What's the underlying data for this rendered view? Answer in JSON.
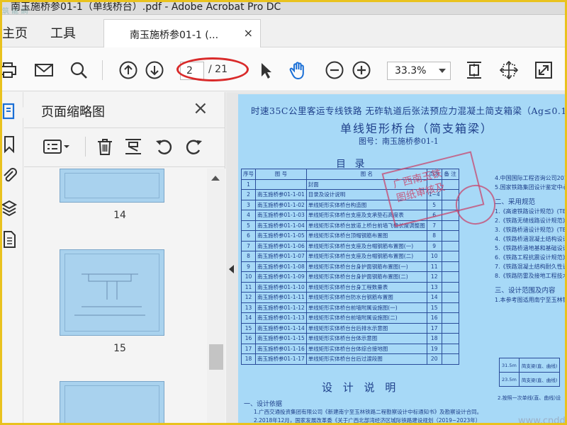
{
  "window": {
    "title": "南玉施桥参01-1（单线桥台）.pdf - Adobe Acrobat Pro DC",
    "logo_text": "筑 龍 網"
  },
  "menu": {
    "home": "主页",
    "tools": "工具"
  },
  "tab": {
    "label": "南玉施桥参01-1 (...",
    "close": "×"
  },
  "toolbar": {
    "page_current": "2",
    "page_total": "/ 21",
    "zoom": "33.3%",
    "icons": [
      "print-icon",
      "email-icon",
      "search-icon",
      "prev-page-icon",
      "next-page-icon",
      "select-cursor-icon",
      "hand-icon",
      "zoom-out-icon",
      "zoom-in-icon",
      "fit-page-icon",
      "fit-width-icon",
      "fullscreen-icon"
    ],
    "accent_color": "#1a6fd6",
    "annotation_color": "#d92a2a"
  },
  "thumbnails_panel": {
    "title": "页面缩略图",
    "close": "×",
    "tools": [
      "thumbnail-options-icon",
      "delete-icon",
      "crop-icon",
      "rotate-left-icon",
      "rotate-right-icon"
    ],
    "pages": [
      "14",
      "15"
    ]
  },
  "document": {
    "header_line": "时速35C公里客运专线铁路    无砟轨道后张法预应力混凝土简支箱梁（Ag≤0.15g）",
    "title": "单线矩形桥台（简支箱梁）",
    "drawing_no": "图号：南玉施桥参01-1",
    "toc_title": "目 录",
    "toc_headers": [
      "序号",
      "图 号",
      "图 名",
      "页次",
      "备 注"
    ],
    "toc_rows": [
      [
        "1",
        "",
        "封面",
        "",
        ""
      ],
      [
        "2",
        "南玉施桥参01-1-01",
        "目录及设计说明",
        "1~4",
        ""
      ],
      [
        "3",
        "南玉施桥参01-1-02",
        "单线矩形实体桥台构造图",
        "5",
        ""
      ],
      [
        "4",
        "南玉施桥参01-1-03",
        "单线矩形实体桥台支座及支承垫石高度表",
        "6",
        ""
      ],
      [
        "5",
        "南玉施桥参01-1-04",
        "单线矩形实体桥台放道上桥台前墙飞檐长度调整图",
        "7",
        ""
      ],
      [
        "6",
        "南玉施桥参01-1-05",
        "单线矩形实体桥台顶帽钢筋布置图",
        "8",
        ""
      ],
      [
        "7",
        "南玉施桥参01-1-06",
        "单线矩形实体桥台支座及台帽钢筋布置图(一)",
        "9",
        ""
      ],
      [
        "8",
        "南玉施桥参01-1-07",
        "单线矩形实体桥台支座及台帽钢筋布置图(二)",
        "10",
        ""
      ],
      [
        "9",
        "南玉施桥参01-1-08",
        "单线矩形实体桥台台身护面钢筋布置图(一)",
        "11",
        ""
      ],
      [
        "10",
        "南玉施桥参01-1-09",
        "单线矩形实体桥台台身护面钢筋布置图(二)",
        "12",
        ""
      ],
      [
        "11",
        "南玉施桥参01-1-10",
        "单线矩形实体桥台台身工程数量表",
        "13",
        ""
      ],
      [
        "12",
        "南玉施桥参01-1-11",
        "单线矩形实体桥台防水台钢筋布置图",
        "14",
        ""
      ],
      [
        "13",
        "南玉施桥参01-1-12",
        "单线矩形实体桥台前墙附属设施图(一)",
        "15",
        ""
      ],
      [
        "14",
        "南玉施桥参01-1-13",
        "单线矩形实体桥台前墙附属设施图(二)",
        "16",
        ""
      ],
      [
        "15",
        "南玉施桥参01-1-14",
        "单线矩形实体桥台台后排水示意图",
        "17",
        ""
      ],
      [
        "16",
        "南玉施桥参01-1-15",
        "单线矩形实体桥台台体示意图",
        "18",
        ""
      ],
      [
        "17",
        "南玉施桥参01-1-16",
        "单线矩形实体桥台台体综合接地图",
        "19",
        ""
      ],
      [
        "18",
        "南玉施桥参01-1-17",
        "单线矩形实体桥台台后过渡段图",
        "20",
        ""
      ]
    ],
    "stamp_text": [
      "广西南玉铁",
      "图纸审核及"
    ],
    "right_notes": [
      "4.中国国际工程咨询公司2018年",
      "5.国家铁路集团设计鉴定中心《",
      "二、采用规范",
      "1.《高速铁路设计规范》(TB 1",
      "2.《铁路无缝线路设计规范》",
      "3.《铁路桥涵设计规范》(TB 1",
      "4.《铁路桥涵混凝土结构设计规",
      "5.《铁路桥涵地基和基础设计规",
      "6.《铁路工程抗震设计规范》",
      "7.《铁路混凝土结构耐久性设计",
      "8.《铁路防雷及接地工程技术规",
      "三、设计范围及内容",
      "1.本参考图适用南宁至玉林铁"
    ],
    "small_table": [
      [
        "31.5m",
        "简支梁(直、曲线)"
      ],
      [
        "23.5m",
        "简支梁(直、曲线)"
      ]
    ],
    "small_note": "2.按照一次单线(直、曲线)设",
    "desc_title": "设 计 说 明",
    "desc_line1": "一、设计依据",
    "desc_line2": "1.广西交通投资集团有限公司《新建南宁至玉林铁路二程勘察设计中标通知书》及勘察设计合同。",
    "desc_line3": "2.2018年12月，国家发展改革委《关于广西北部湾经济区城际铁路建设规划（2019~2023年）",
    "watermark": "www.cnddc.com"
  }
}
